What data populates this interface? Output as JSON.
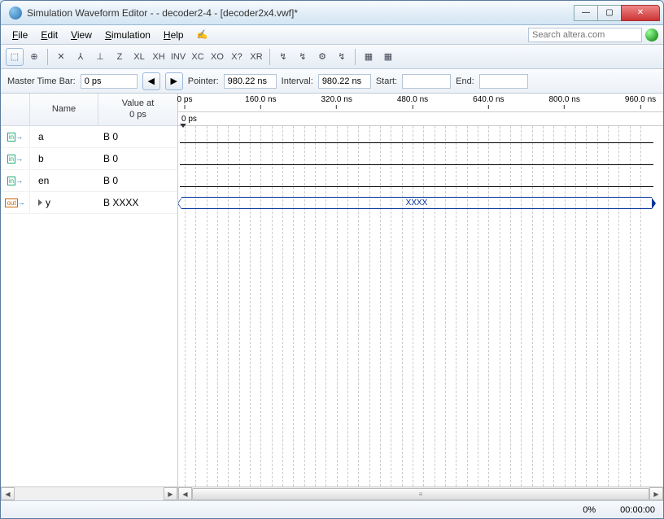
{
  "titlebar": {
    "title": "Simulation Waveform Editor -                                          - decoder2-4 - [decoder2x4.vwf]*"
  },
  "menu": {
    "items": [
      "File",
      "Edit",
      "View",
      "Simulation",
      "Help"
    ]
  },
  "search": {
    "placeholder": "Search altera.com"
  },
  "timebar": {
    "master_label": "Master Time Bar:",
    "master_value": "0 ps",
    "pointer_label": "Pointer:",
    "pointer_value": "980.22 ns",
    "interval_label": "Interval:",
    "interval_value": "980.22 ns",
    "start_label": "Start:",
    "start_value": "",
    "end_label": "End:",
    "end_value": ""
  },
  "columns": {
    "name": "Name",
    "value": "Value at\n0 ps"
  },
  "signals": [
    {
      "dir": "in",
      "name": "a",
      "value": "B 0",
      "wave": "low"
    },
    {
      "dir": "in",
      "name": "b",
      "value": "B 0",
      "wave": "low"
    },
    {
      "dir": "in",
      "name": "en",
      "value": "B 0",
      "wave": "low"
    },
    {
      "dir": "out",
      "name": "y",
      "value": "B XXXX",
      "wave": "bus",
      "bus_text": "XXXX",
      "expandable": true
    }
  ],
  "ruler": {
    "ticks": [
      "0 ps",
      "160.0 ns",
      "320.0 ns",
      "480.0 ns",
      "640.0 ns",
      "800.0 ns",
      "960.0 ns"
    ],
    "sub": "0 ps"
  },
  "status": {
    "pct": "0%",
    "time": "00:00:00"
  },
  "toolbar_icons": [
    "⬚",
    "⊕",
    "|",
    "✕",
    "⅄",
    "⊥",
    "Z",
    "XL",
    "XH",
    "INV",
    "XC",
    "XO",
    "X?",
    "XR",
    "|",
    "↯",
    "↯",
    "⚙",
    "↯",
    "|",
    "▦",
    "▦"
  ]
}
